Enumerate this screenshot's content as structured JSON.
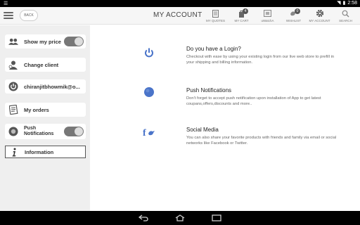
{
  "status_bar": {
    "time": "2:58",
    "left_icon": "menu-lines-icon",
    "right_icons": [
      "wifi-icon",
      "battery-icon"
    ]
  },
  "header": {
    "back_label": "BACK",
    "title": "MY ACCOUNT",
    "nav": [
      {
        "label": "MY QUOTES",
        "icon": "document-icon"
      },
      {
        "label": "MY CART",
        "icon": "cart-icon",
        "badge": "4"
      },
      {
        "label": "uWatchA",
        "icon": "watch-icon"
      },
      {
        "label": "WISHLIST",
        "icon": "bird-icon",
        "badge": "0"
      },
      {
        "label": "MY ACCOUNT",
        "icon": "gear-icon"
      },
      {
        "label": "SEARCH",
        "icon": "search-icon"
      }
    ]
  },
  "sidebar": {
    "items": [
      {
        "label": "Show my price",
        "icon": "users-icon",
        "toggle": true
      },
      {
        "label": "Change client",
        "icon": "user-swap-icon"
      },
      {
        "label": "chiranjitbhowmik@o...",
        "icon": "power-icon"
      },
      {
        "label": "My orders",
        "icon": "orders-icon"
      },
      {
        "label": "Push\nNotifications",
        "label_line1": "Push",
        "label_line2": "Notifications",
        "icon": "radio-dot-icon",
        "toggle": true
      },
      {
        "label": "Information",
        "icon": "info-icon"
      }
    ]
  },
  "sections": [
    {
      "title": "Do you have a Login?",
      "desc": "Checkout with ease by using your existing login from our live web store to prefill in your shipping and billing information.",
      "icon": "power-icon"
    },
    {
      "title": "Push Notifications",
      "desc": "Don't forget to accept push notification upon installation of App to get latest coupans,offers,discounts and more..",
      "icon": "blue-dot-icon"
    },
    {
      "title": "Social Media",
      "desc": "You can also share your favorite products with friends and family via email or social networks like Facebook or Twitter.",
      "icon": "facebook-twitter-icon"
    }
  ],
  "colors": {
    "accent_blue": "#4a74c9",
    "toggle_bg": "#777777",
    "sidebar_bg": "#efefef"
  }
}
